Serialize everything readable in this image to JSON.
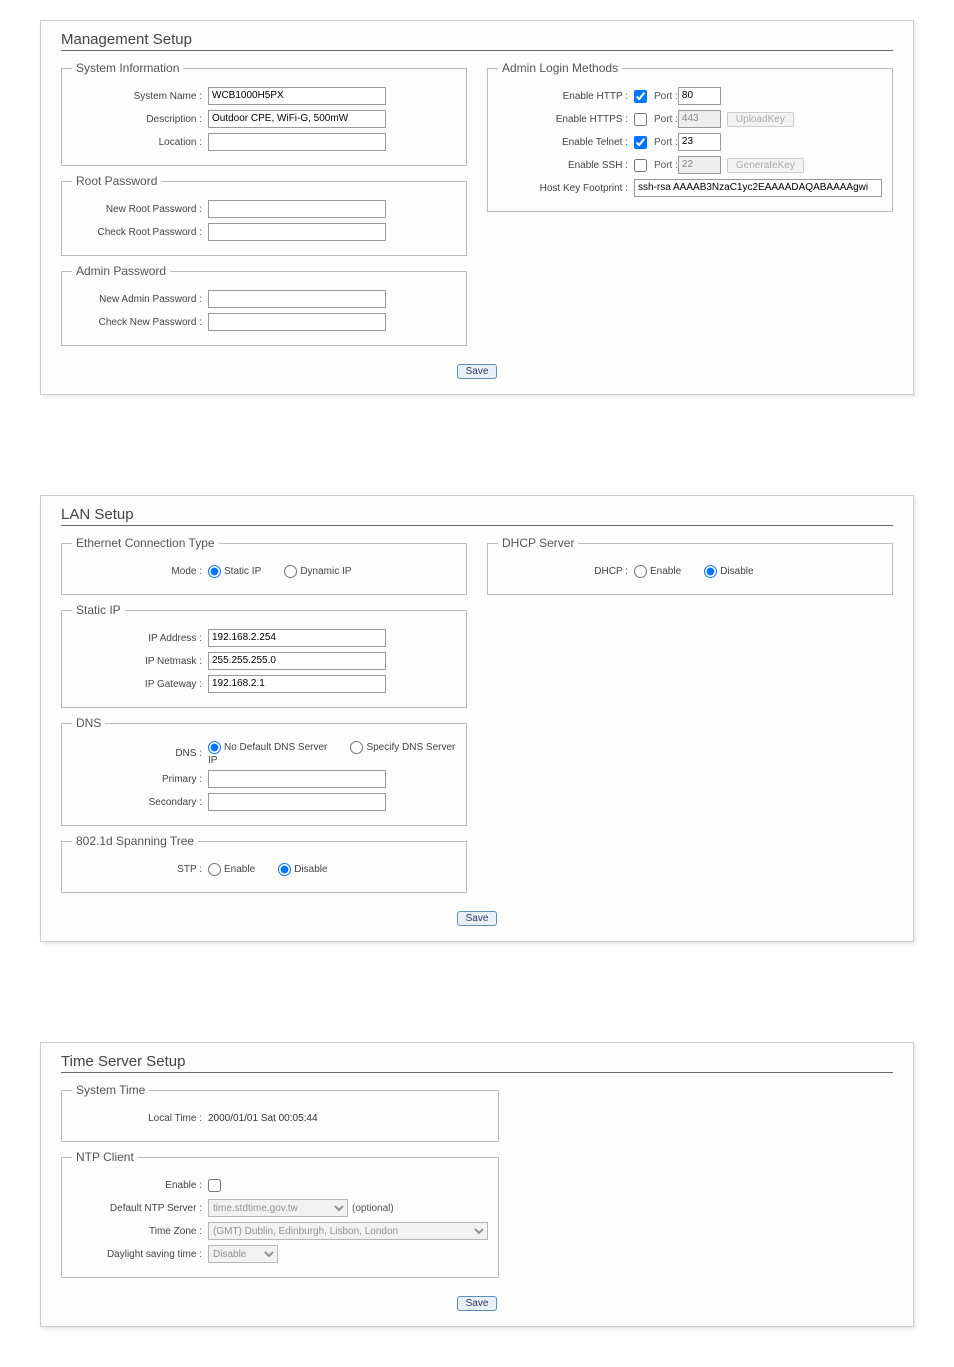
{
  "mgmt": {
    "title": "Management Setup",
    "sysinfo": {
      "legend": "System Information",
      "system_name_label": "System Name :",
      "system_name": "WCB1000H5PX",
      "description_label": "Description :",
      "description": "Outdoor CPE, WiFi-G, 500mW",
      "location_label": "Location :",
      "location": ""
    },
    "rootpw": {
      "legend": "Root Password",
      "new_label": "New Root Password :",
      "check_label": "Check Root Password :"
    },
    "adminpw": {
      "legend": "Admin Password",
      "new_label": "New Admin Password :",
      "check_label": "Check New Password :"
    },
    "login": {
      "legend": "Admin Login Methods",
      "http_label": "Enable HTTP :",
      "http_checked": true,
      "http_port": "80",
      "https_label": "Enable HTTPS :",
      "https_checked": false,
      "https_port": "443",
      "uploadkey_btn": "UploadKey",
      "telnet_label": "Enable Telnet :",
      "telnet_checked": true,
      "telnet_port": "23",
      "ssh_label": "Enable SSH :",
      "ssh_checked": false,
      "ssh_port": "22",
      "genkey_btn": "GenerateKey",
      "footprint_label": "Host Key Footprint :",
      "footprint": "ssh-rsa AAAAB3NzaC1yc2EAAAADAQABAAAAgwi",
      "port_label": "Port :"
    },
    "save": "Save"
  },
  "lan": {
    "title": "LAN Setup",
    "conn": {
      "legend": "Ethernet Connection Type",
      "mode_label": "Mode :",
      "static": "Static IP",
      "dynamic": "Dynamic IP"
    },
    "static": {
      "legend": "Static IP",
      "addr_label": "IP Address :",
      "addr": "192.168.2.254",
      "mask_label": "IP Netmask :",
      "mask": "255.255.255.0",
      "gw_label": "IP Gateway :",
      "gw": "192.168.2.1"
    },
    "dns": {
      "legend": "DNS",
      "dns_label": "DNS :",
      "nodef": "No Default DNS Server",
      "spec": "Specify DNS Server IP",
      "primary_label": "Primary :",
      "secondary_label": "Secondary :"
    },
    "stp": {
      "legend": "802.1d Spanning Tree",
      "stp_label": "STP :",
      "enable": "Enable",
      "disable": "Disable"
    },
    "dhcp": {
      "legend": "DHCP Server",
      "dhcp_label": "DHCP :",
      "enable": "Enable",
      "disable": "Disable"
    },
    "save": "Save"
  },
  "time": {
    "title": "Time Server Setup",
    "systime": {
      "legend": "System Time",
      "local_label": "Local Time :",
      "local_value": "2000/01/01 Sat 00:05:44"
    },
    "ntp": {
      "legend": "NTP Client",
      "enable_label": "Enable :",
      "enable_checked": false,
      "default_label": "Default NTP Server :",
      "default_value": "time.stdtime.gov.tw",
      "optional": "(optional)",
      "tz_label": "Time Zone :",
      "tz_value": "(GMT) Dublin, Edinburgh, Lisbon, London",
      "dst_label": "Daylight saving time :",
      "dst_value": "Disable"
    },
    "save": "Save"
  }
}
